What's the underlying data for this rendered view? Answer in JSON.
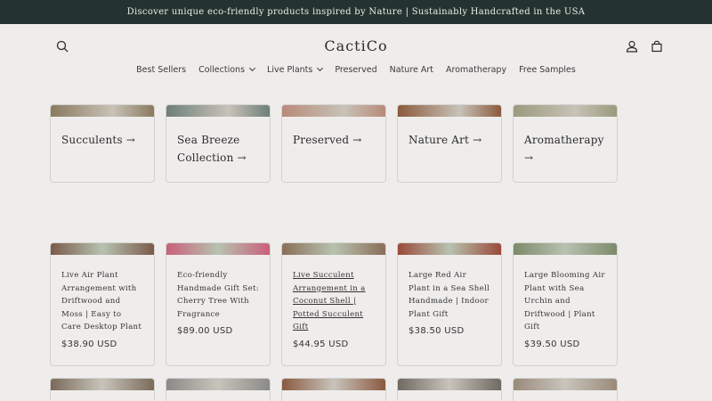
{
  "announcement": "Discover unique eco-friendly products inspired by Nature | Sustainably Handcrafted in the USA",
  "header": {
    "logo": "CactiCo",
    "icons": {
      "search": "search-icon",
      "account": "account-icon",
      "cart": "cart-icon"
    }
  },
  "nav": [
    {
      "label": "Best Sellers",
      "dropdown": false
    },
    {
      "label": "Collections",
      "dropdown": true
    },
    {
      "label": "Live Plants",
      "dropdown": true
    },
    {
      "label": "Preserved",
      "dropdown": false
    },
    {
      "label": "Nature Art",
      "dropdown": false
    },
    {
      "label": "Aromatherapy",
      "dropdown": false
    },
    {
      "label": "Free Samples",
      "dropdown": false
    }
  ],
  "collections": [
    {
      "title": "Succulents →",
      "color": "#8a7a5e"
    },
    {
      "title": "Sea Breeze Collection →",
      "color": "#6e7f78"
    },
    {
      "title": "Preserved →",
      "color": "#b88a7a"
    },
    {
      "title": "Nature Art →",
      "color": "#8b5a3c"
    },
    {
      "title": "Aromatherapy →",
      "color": "#9a9a7c"
    }
  ],
  "products": [
    {
      "title": "Live Air Plant Arrangement with Driftwood and Moss | Easy to Care Desktop Plant",
      "price": "$38.90 USD",
      "color": "#7a5a4a"
    },
    {
      "title": "Eco-friendly Handmade Gift Set: Cherry Tree With Fragrance",
      "price": "$89.00 USD",
      "color": "#c9607a"
    },
    {
      "title": "Live Succulent Arrangement in a Coconut Shell | Potted Succulent Gift",
      "price": "$44.95 USD",
      "color": "#8a6e58",
      "underlined": true
    },
    {
      "title": "Large Red Air Plant in a Sea Shell Handmade | Indoor Plant Gift",
      "price": "$38.50 USD",
      "color": "#9a4a3a"
    },
    {
      "title": "Large Blooming Air Plant with Sea Urchin and Driftwood | Plant Gift",
      "price": "$39.50 USD",
      "color": "#7c8a6a"
    }
  ],
  "row3_colors": [
    "#7a6a5a",
    "#8a8a86",
    "#8a5a40",
    "#6e6a62",
    "#9a8a7a"
  ]
}
